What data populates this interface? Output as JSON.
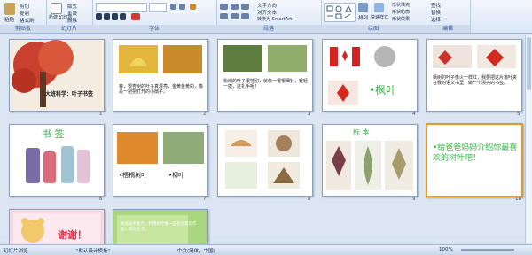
{
  "ribbon": {
    "groups": [
      {
        "label": "剪贴板"
      },
      {
        "label": "幻灯片"
      },
      {
        "label": "字体"
      },
      {
        "label": "段落"
      },
      {
        "label": "绘图"
      },
      {
        "label": "编辑"
      }
    ],
    "paste_label": "粘贴",
    "cut_label": "剪切",
    "copy_label": "复制",
    "format_painter_label": "格式刷",
    "new_slide_label": "新建\n幻灯片",
    "layout_label": "版式",
    "reset_label": "重设",
    "delete_label": "删除",
    "text_direction_label": "文字方向",
    "align_text_label": "对齐文本",
    "smartart_label": "转换为 SmartArt",
    "arrange_label": "排列",
    "quick_styles_label": "快速样式",
    "shape_fill_label": "形状填充",
    "shape_outline_label": "形状轮廓",
    "shape_effects_label": "形状效果",
    "find_label": "查找",
    "replace_label": "替换",
    "select_label": "选择"
  },
  "slides": [
    {
      "num": "1",
      "title": "大班科学：叶子书签"
    },
    {
      "num": "2",
      "text": "春，银杏树的叶子真漂亮，金黄金黄的，像是一把把打开的小扇子。"
    },
    {
      "num": "3",
      "text": "松树的叶子很特别，就像一根根细针，轻轻一摸，还扎手呢！"
    },
    {
      "num": "4",
      "text": "•枫叶"
    },
    {
      "num": "5",
      "text": "枫树的叶子像火一样红，我要把这片落叶夹在我的语文书里，做一个漂亮的书签。"
    },
    {
      "num": "6",
      "title": "书 签"
    },
    {
      "num": "7",
      "cap1": "•梧桐树叶",
      "cap2": "•柳叶"
    },
    {
      "num": "8"
    },
    {
      "num": "9",
      "title": "标 本"
    },
    {
      "num": "10",
      "text": "•给爸爸妈妈介绍你最喜欢的树叶吧！"
    },
    {
      "num": "11",
      "text": "谢谢！"
    },
    {
      "num": "12",
      "text": "发挥动手能力，利用树叶做一些有创意的作品，美化生活。"
    }
  ],
  "status": {
    "view": "幻灯片浏览",
    "theme": "\"默认设计模板\"",
    "lang": "中文(简体，中国)",
    "zoom": "100%"
  },
  "colors": {
    "accent": "#e29a2d",
    "ribbon": "#dbe7f5",
    "green_text": "#3bb34a"
  }
}
